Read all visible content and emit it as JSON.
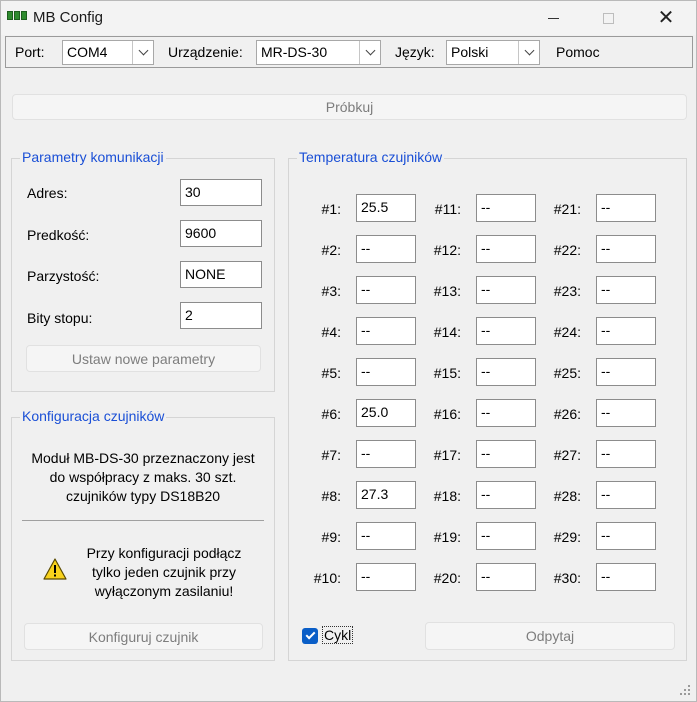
{
  "window": {
    "title": "MB Config"
  },
  "toolbar": {
    "port_label": "Port:",
    "port_value": "COM4",
    "device_label": "Urządzenie:",
    "device_value": "MR-DS-30",
    "language_label": "Język:",
    "language_value": "Polski",
    "help_label": "Pomoc"
  },
  "probe_button": "Próbkuj",
  "comm": {
    "title": "Parametry komunikacji",
    "address_label": "Adres:",
    "address_value": "30",
    "speed_label": "Predkość:",
    "speed_value": "9600",
    "parity_label": "Parzystość:",
    "parity_value": "NONE",
    "stopbits_label": "Bity stopu:",
    "stopbits_value": "2",
    "set_button": "Ustaw nowe parametry"
  },
  "sensor_config": {
    "title": "Konfiguracja czujników",
    "info_lines": [
      "Moduł MB-DS-30 przeznaczony jest",
      "do współpracy z maks. 30 szt.",
      "czujników typy DS18B20"
    ],
    "warning_lines": [
      "Przy konfiguracji podłącz",
      "tylko jeden czujnik przy",
      "wyłączonym zasilaniu!"
    ],
    "configure_button": "Konfiguruj czujnik"
  },
  "temperatures": {
    "title": "Temperatura czujników",
    "sensors": [
      {
        "label": "#1:",
        "value": "25.5"
      },
      {
        "label": "#2:",
        "value": "--"
      },
      {
        "label": "#3:",
        "value": "--"
      },
      {
        "label": "#4:",
        "value": "--"
      },
      {
        "label": "#5:",
        "value": "--"
      },
      {
        "label": "#6:",
        "value": "25.0"
      },
      {
        "label": "#7:",
        "value": "--"
      },
      {
        "label": "#8:",
        "value": "27.3"
      },
      {
        "label": "#9:",
        "value": "--"
      },
      {
        "label": "#10:",
        "value": "--"
      },
      {
        "label": "#11:",
        "value": "--"
      },
      {
        "label": "#12:",
        "value": "--"
      },
      {
        "label": "#13:",
        "value": "--"
      },
      {
        "label": "#14:",
        "value": "--"
      },
      {
        "label": "#15:",
        "value": "--"
      },
      {
        "label": "#16:",
        "value": "--"
      },
      {
        "label": "#17:",
        "value": "--"
      },
      {
        "label": "#18:",
        "value": "--"
      },
      {
        "label": "#19:",
        "value": "--"
      },
      {
        "label": "#20:",
        "value": "--"
      },
      {
        "label": "#21:",
        "value": "--"
      },
      {
        "label": "#22:",
        "value": "--"
      },
      {
        "label": "#23:",
        "value": "--"
      },
      {
        "label": "#24:",
        "value": "--"
      },
      {
        "label": "#25:",
        "value": "--"
      },
      {
        "label": "#26:",
        "value": "--"
      },
      {
        "label": "#27:",
        "value": "--"
      },
      {
        "label": "#28:",
        "value": "--"
      },
      {
        "label": "#29:",
        "value": "--"
      },
      {
        "label": "#30:",
        "value": "--"
      }
    ],
    "cycle_label": "Cykl",
    "cycle_checked": true,
    "read_button": "Odpytaj"
  },
  "colors": {
    "group_title": "#1a4fd6",
    "checkbox": "#0a5ec7",
    "app_icon": "#2e8b2e"
  }
}
